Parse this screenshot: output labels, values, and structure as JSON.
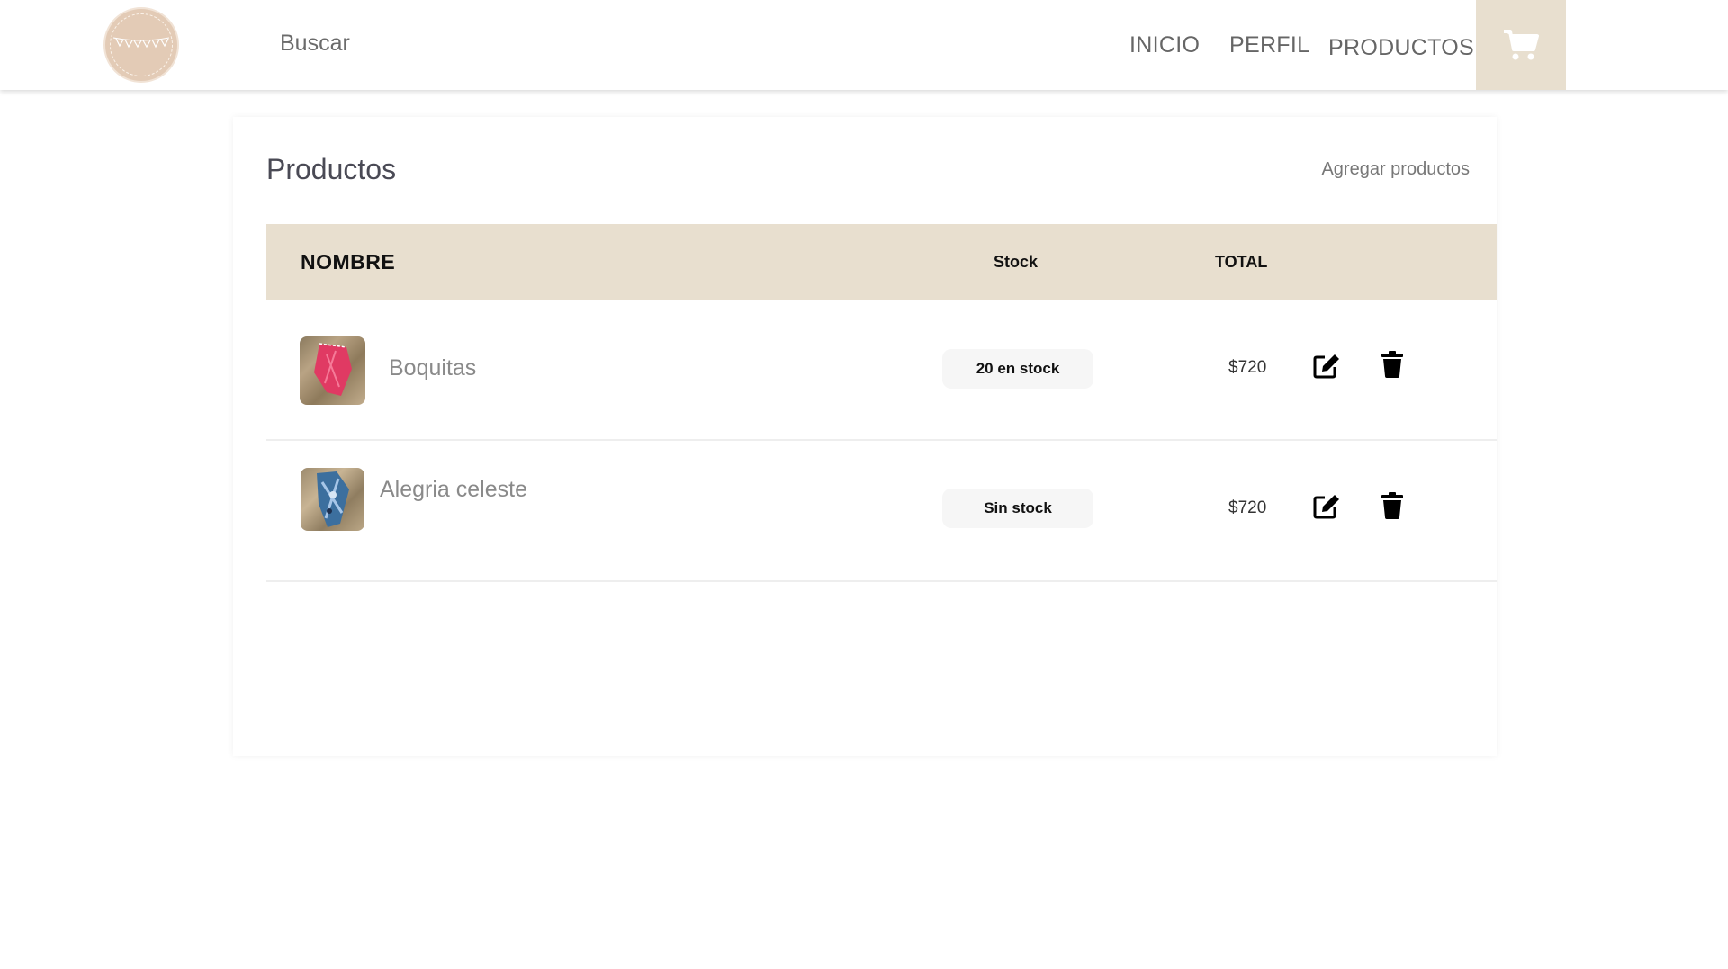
{
  "nav": {
    "search_placeholder": "Buscar",
    "links": [
      "INICIO",
      "PERFIL",
      "PRODUCTOS"
    ],
    "cart_icon": "shopping-cart-icon"
  },
  "page": {
    "title": "Productos",
    "add_link": "Agregar productos"
  },
  "table": {
    "headers": [
      "NOMBRE",
      "Stock",
      "TOTAL"
    ],
    "rows": [
      {
        "name": "Boquitas",
        "stock": "20 en stock",
        "total": "$720",
        "image": "red-scarf"
      },
      {
        "name": "Alegria celeste",
        "stock": "Sin stock",
        "total": "$720",
        "image": "blue-patterned-scarf"
      }
    ]
  },
  "colors": {
    "accent": "#e8dfcf",
    "logo": "#e3cbb6"
  }
}
